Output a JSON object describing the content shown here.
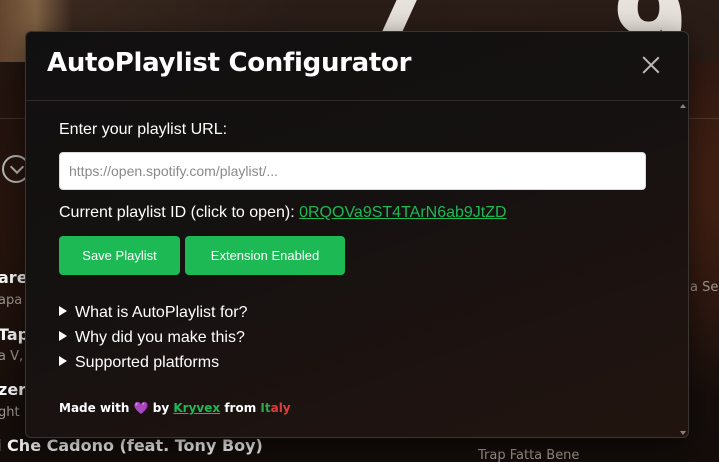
{
  "background": {
    "big_digits": [
      "7",
      "9"
    ],
    "rows": [
      {
        "title": "are",
        "subtitle": "apa"
      },
      {
        "title": "Tap",
        "subtitle": "a V, I"
      },
      {
        "title": "zer",
        "subtitle": "ght"
      },
      {
        "title": "i Che Cadono (feat. Tony Boy)",
        "subtitle": ""
      }
    ],
    "right_texts": [
      "a Ser",
      "Trap Fatta Bene"
    ],
    "download_icon": "download-circle-icon"
  },
  "modal": {
    "title": "AutoPlaylist Configurator",
    "close_icon": "close-icon",
    "url_label": "Enter your playlist URL:",
    "url_value": "",
    "url_placeholder": "https://open.spotify.com/playlist/...",
    "current_id_label": "Current playlist ID (click to open):",
    "current_id": "0RQOVa9ST4TArN6ab9JtZD",
    "save_button": "Save Playlist",
    "extension_button": "Extension Enabled",
    "faq": [
      "What is AutoPlaylist for?",
      "Why did you make this?",
      "Supported platforms"
    ],
    "footer": {
      "made_with": "Made with",
      "heart": "💜",
      "by": "by",
      "author": "Kryvex",
      "from": "from",
      "country_green": "It",
      "country_red": "aly"
    }
  },
  "colors": {
    "accent": "#1db954",
    "heart": "#8c5cf2",
    "italy_red": "#e23b3b"
  }
}
